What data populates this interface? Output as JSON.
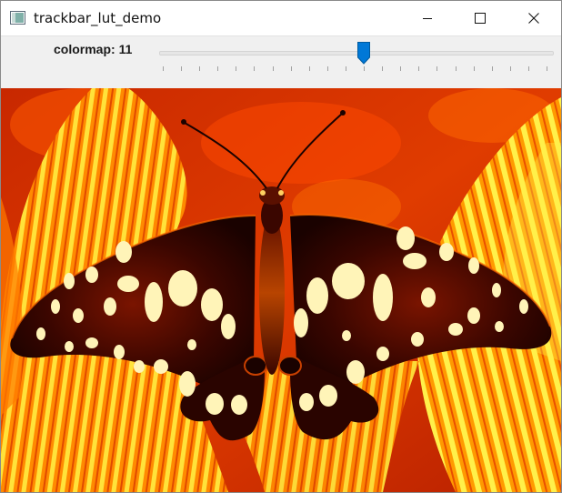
{
  "window": {
    "title": "trackbar_lut_demo",
    "icon": "opencv-window-icon"
  },
  "controls": {
    "minimize_icon": "minimize-icon",
    "maximize_icon": "maximize-icon",
    "close_icon": "close-icon"
  },
  "trackbar": {
    "name": "colormap",
    "label": "colormap: 11",
    "value": 11,
    "min": 0,
    "max": 21,
    "tick_count": 22,
    "accent_color": "#0078d7"
  },
  "image": {
    "description_icon": "image-display",
    "palette": [
      "#2a0400",
      "#7a0c00",
      "#d43000",
      "#ff6a00",
      "#ffb000",
      "#fff04a",
      "#fff8c0"
    ]
  }
}
